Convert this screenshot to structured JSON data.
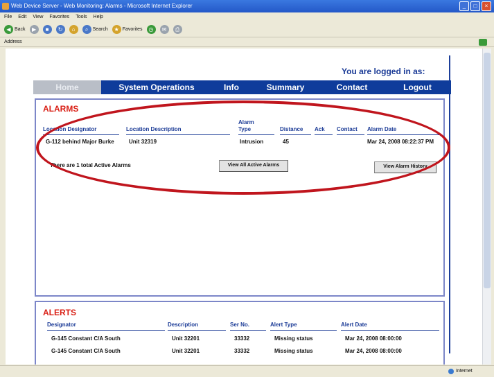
{
  "window": {
    "title": "Web Device Server - Web Monitoring: Alarms - Microsoft Internet Explorer",
    "menu": [
      "File",
      "Edit",
      "View",
      "Favorites",
      "Tools",
      "Help"
    ],
    "toolbar": {
      "back": "Back",
      "search": "Search",
      "favorites": "Favorites"
    },
    "address_label": "Address",
    "status_zone": "Internet"
  },
  "page": {
    "login_text": "You are logged in as:",
    "nav": [
      "Home",
      "System Operations",
      "Info",
      "Summary",
      "Contact",
      "Logout"
    ],
    "alarms": {
      "title": "ALARMS",
      "headers": [
        "Location Designator",
        "Location Description",
        "Alarm Type",
        "Distance",
        "Ack",
        "Contact",
        "Alarm Date"
      ],
      "rows": [
        [
          "G-112 behind Major Burke",
          "Unit 32319",
          "Intrusion",
          "45",
          "",
          "",
          "Mar 24, 2008  08:22:37 PM"
        ]
      ],
      "summary": "There are 1 total Active Alarms",
      "view_all_button": "View All Active Alarms",
      "view_history_button": "View Alarm History"
    },
    "alerts": {
      "title": "ALERTS",
      "headers": [
        "Designator",
        "Description",
        "Ser No.",
        "Alert Type",
        "Alert Date"
      ],
      "rows": [
        [
          "G-145 Constant C/A South",
          "Unit 32201",
          "33332",
          "Missing status",
          "Mar 24, 2008  08:00:00"
        ],
        [
          "G-145 Constant C/A South",
          "Unit 32201",
          "33332",
          "Missing status",
          "Mar 24, 2008  08:00:00"
        ]
      ]
    }
  },
  "colors": {
    "nav_bg": "#0f3c9b",
    "panel_title": "#d91f15",
    "header_text": "#1a3a96",
    "highlight_ellipse": "#c0151d"
  }
}
